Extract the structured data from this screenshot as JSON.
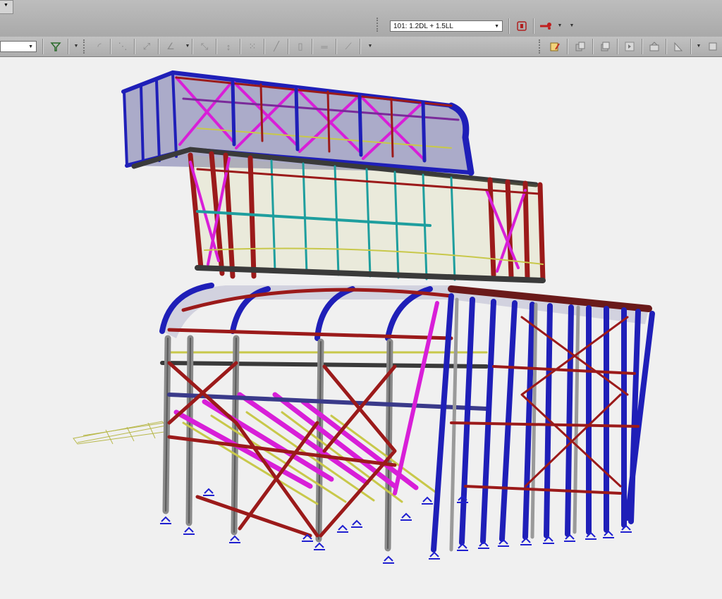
{
  "toolbar_top": {
    "load_combination": "101: 1.2DL + 1.5LL",
    "icons": [
      "dropdown-stub",
      "load-combo-select",
      "display-loads-icon",
      "member-release-icon",
      "dropdown-arrow"
    ]
  },
  "toolbar_second": {
    "left_combo_value": "",
    "filter_icon": "filter-icon",
    "draw_tools": [
      "arc-icon",
      "dash-line-icon",
      "diagonal-icon",
      "angle-icon",
      "grid-snap-icon",
      "vertical-arrow-icon",
      "dotted-grid-icon",
      "line-tool-icon",
      "column-icon",
      "horizontal-member-icon",
      "slope-icon"
    ],
    "right_tools": [
      "edit-note-icon",
      "copy-icon",
      "stack-icon",
      "next-icon",
      "panel-icon",
      "slope-panel-icon",
      "overflow-menu-icon"
    ]
  },
  "viewport": {
    "content": "3D structural steel frame model",
    "colors": {
      "background": "#f0f0f0",
      "blue_member": "#1f1fb8",
      "red_member": "#9b1a1a",
      "magenta_member": "#d81fd8",
      "teal_member": "#1e9e9e",
      "grey_member": "#8a8a8a",
      "yellow_member": "#c8c84a",
      "support": "#2020d0"
    }
  }
}
